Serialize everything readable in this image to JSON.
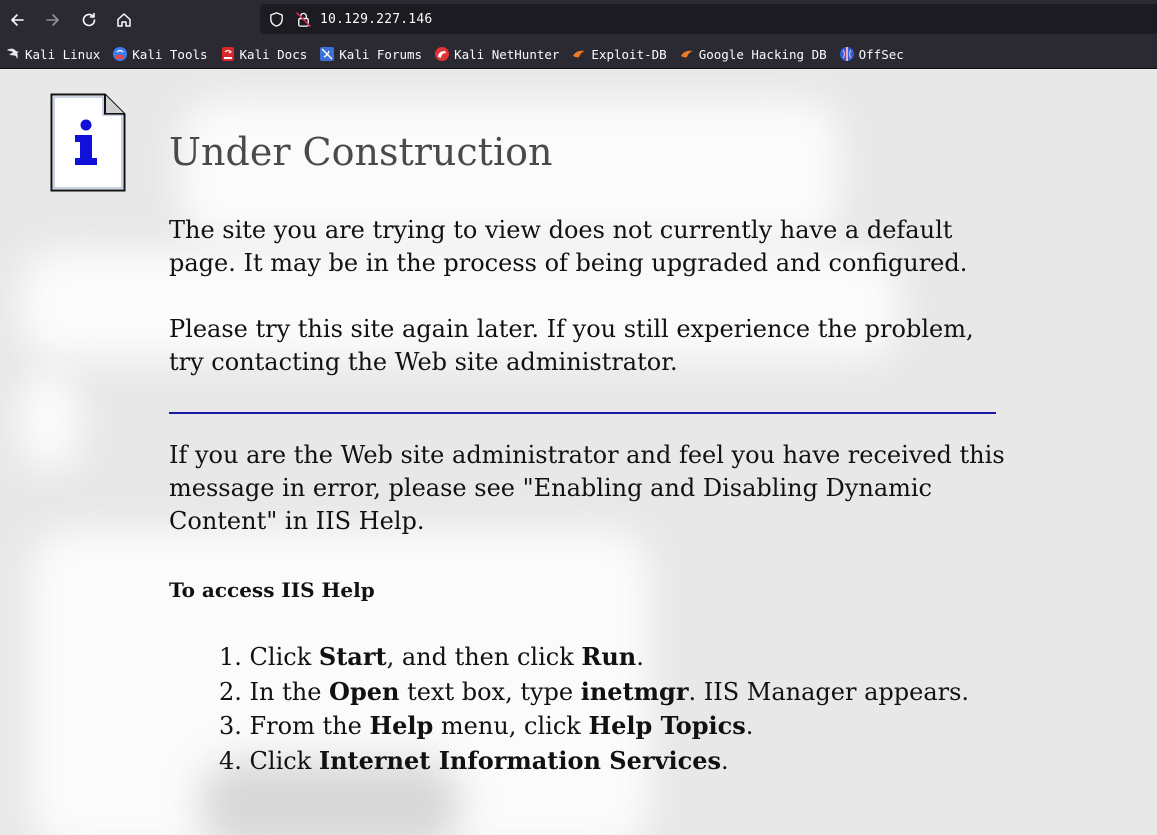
{
  "browser": {
    "url": "10.129.227.146",
    "bookmarks": [
      {
        "label": "Kali Linux",
        "icon": "kali-dragon-icon"
      },
      {
        "label": "Kali Tools",
        "icon": "kali-tools-icon"
      },
      {
        "label": "Kali Docs",
        "icon": "kali-docs-icon"
      },
      {
        "label": "Kali Forums",
        "icon": "kali-forums-icon"
      },
      {
        "label": "Kali NetHunter",
        "icon": "kali-nethunter-icon"
      },
      {
        "label": "Exploit-DB",
        "icon": "exploit-db-icon"
      },
      {
        "label": "Google Hacking DB",
        "icon": "ghdb-icon"
      },
      {
        "label": "OffSec",
        "icon": "offsec-icon"
      }
    ]
  },
  "page": {
    "title": "Under Construction",
    "para1": "The site you are trying to view does not currently have a default page. It may be in the process of being upgraded and configured.",
    "para2": "Please try this site again later. If you still experience the problem, try contacting the Web site administrator.",
    "para3": "If you are the Web site administrator and feel you have received this message in error, please see \"Enabling and Disabling Dynamic Content\" in IIS Help.",
    "subheading": "To access IIS Help",
    "steps": [
      {
        "num": "1.",
        "parts": [
          {
            "t": "Click "
          },
          {
            "t": "Start",
            "b": true
          },
          {
            "t": ", and then click "
          },
          {
            "t": "Run",
            "b": true
          },
          {
            "t": "."
          }
        ]
      },
      {
        "num": "2.",
        "parts": [
          {
            "t": "In the "
          },
          {
            "t": "Open",
            "b": true
          },
          {
            "t": " text box, type "
          },
          {
            "t": "inetmgr",
            "b": true
          },
          {
            "t": ". IIS Manager appears."
          }
        ]
      },
      {
        "num": "3.",
        "parts": [
          {
            "t": "From the "
          },
          {
            "t": "Help",
            "b": true
          },
          {
            "t": " menu, click "
          },
          {
            "t": "Help Topics",
            "b": true
          },
          {
            "t": "."
          }
        ]
      },
      {
        "num": "4.",
        "parts": [
          {
            "t": "Click "
          },
          {
            "t": "Internet Information Services",
            "b": true
          },
          {
            "t": "."
          }
        ]
      }
    ]
  },
  "colors": {
    "chrome_bg": "#2b2a33",
    "urlbar_bg": "#1c1b22",
    "rule": "#1a1aa6",
    "title_text": "#4a4a4a"
  }
}
